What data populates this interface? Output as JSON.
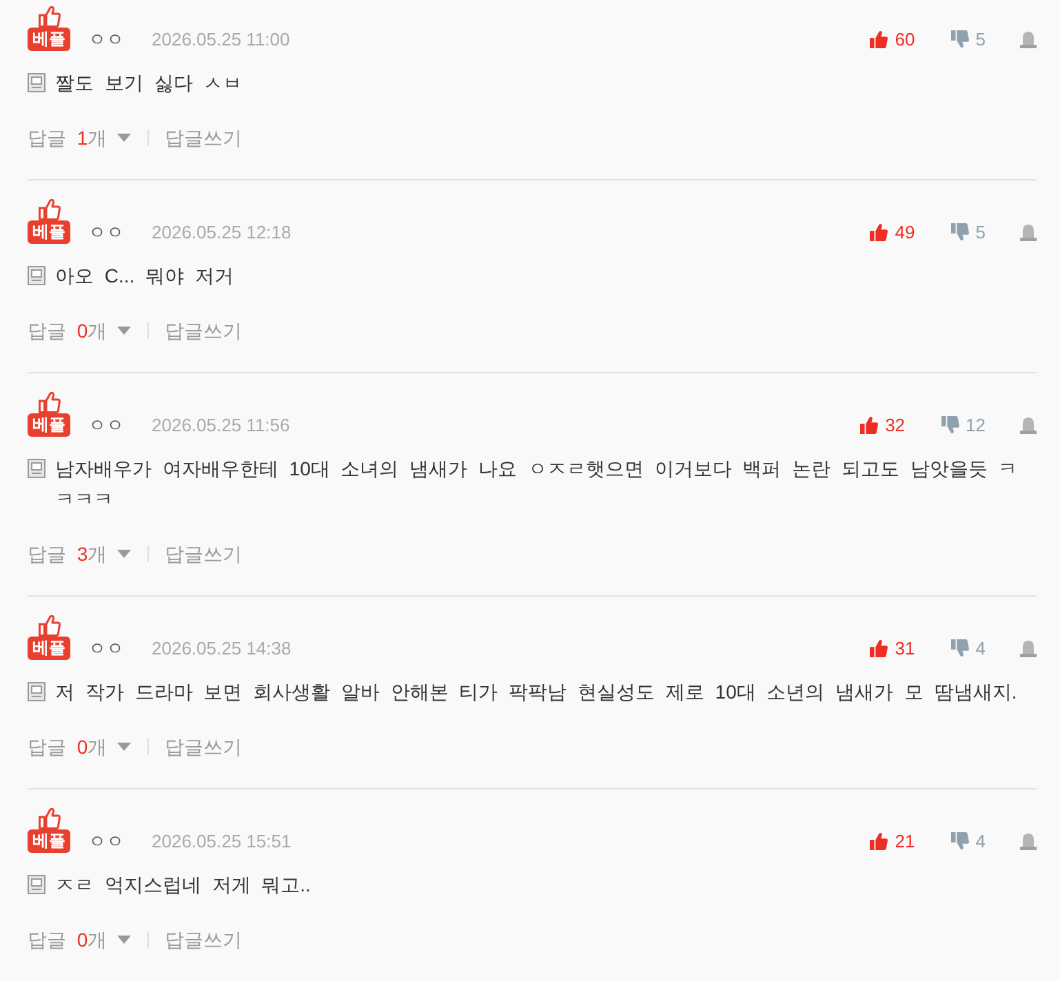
{
  "comments": [
    {
      "badge": "베플",
      "author": "ㅇㅇ",
      "date": "2026.05.25 11:00",
      "text": "짤도 보기 싫다 ㅅㅂ",
      "likes": "60",
      "dislikes": "5",
      "reply_label": "답글",
      "reply_count": "1",
      "reply_unit": "개",
      "replies_expanded": false,
      "write_reply": "답글쓰기"
    },
    {
      "badge": "베플",
      "author": "ㅇㅇ",
      "date": "2026.05.25 12:18",
      "text": "아오 C... 뭐야 저거",
      "likes": "49",
      "dislikes": "5",
      "reply_label": "답글",
      "reply_count": "0",
      "reply_unit": "개",
      "replies_expanded": false,
      "write_reply": "답글쓰기"
    },
    {
      "badge": "베플",
      "author": "ㅇㅇ",
      "date": "2026.05.25 11:56",
      "text": "남자배우가 여자배우한테 10대 소녀의 냄새가 나요 ㅇㅈㄹ햇으면 이거보다 백퍼 논란 되고도 남앗을듯 ㅋㅋㅋㅋ",
      "likes": "32",
      "dislikes": "12",
      "reply_label": "답글",
      "reply_count": "3",
      "reply_unit": "개",
      "replies_expanded": false,
      "write_reply": "답글쓰기"
    },
    {
      "badge": "베플",
      "author": "ㅇㅇ",
      "date": "2026.05.25 14:38",
      "text": "저 작가 드라마 보면 회사생활 알바 안해본 티가 팍팍남 현실성도 제로 10대 소년의 냄새가 모 땀냄새지.",
      "likes": "31",
      "dislikes": "4",
      "reply_label": "답글",
      "reply_count": "0",
      "reply_unit": "개",
      "replies_expanded": false,
      "write_reply": "답글쓰기"
    },
    {
      "badge": "베플",
      "author": "ㅇㅇ",
      "date": "2026.05.25 15:51",
      "text": "ㅈㄹ 억지스럽네 저게 뭐고..",
      "likes": "21",
      "dislikes": "4",
      "reply_label": "답글",
      "reply_count": "0",
      "reply_unit": "개",
      "replies_expanded": false,
      "write_reply": "답글쓰기"
    }
  ]
}
